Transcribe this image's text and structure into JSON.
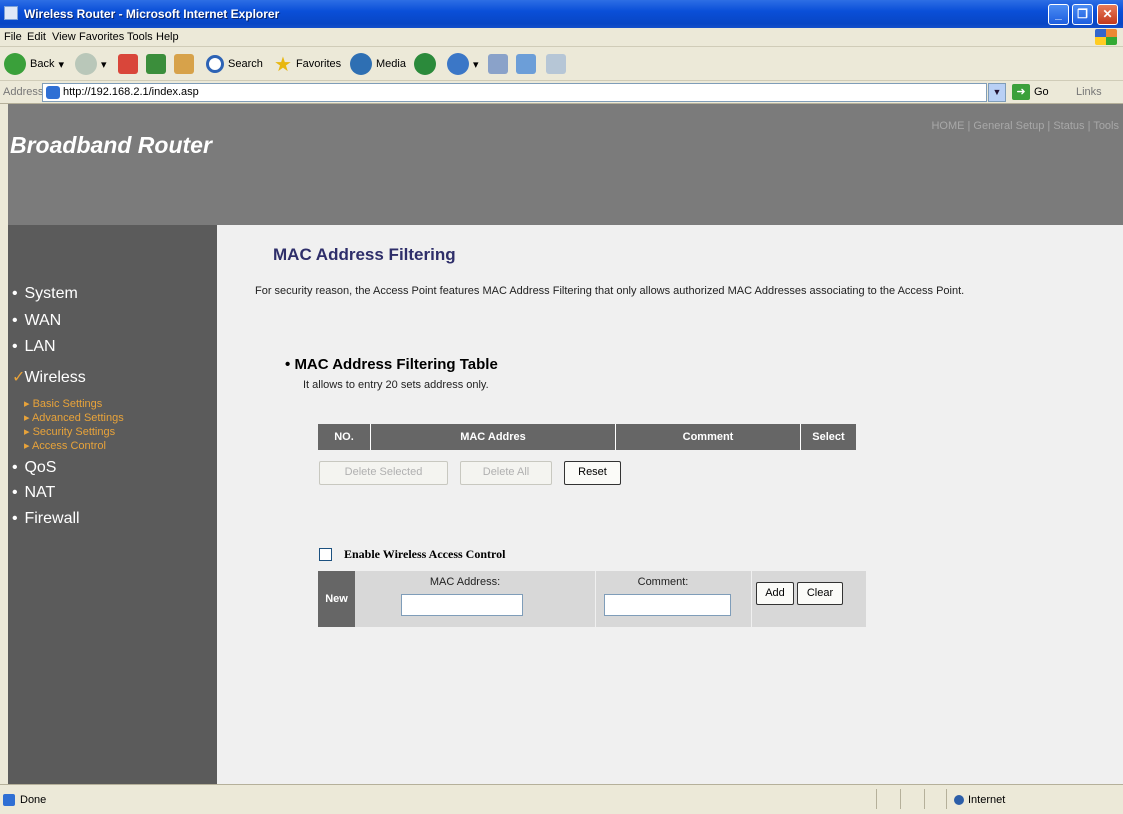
{
  "window": {
    "title": "Wireless Router - Microsoft Internet Explorer"
  },
  "menu": [
    "File",
    "Edit",
    "View",
    "Favorites",
    "Tools",
    "Help"
  ],
  "toolbar": {
    "back": "Back",
    "search": "Search",
    "favorites": "Favorites",
    "media": "Media"
  },
  "address": {
    "label": "Address",
    "url": "http://192.168.2.1/index.asp",
    "go": "Go",
    "links": "Links"
  },
  "header": {
    "brand": "Broadband Router",
    "nav": [
      "HOME",
      "General Setup",
      "Status",
      "Tools"
    ],
    "separator": "|"
  },
  "sidebar": {
    "items": [
      {
        "bullet": "•",
        "label": "System"
      },
      {
        "bullet": "•",
        "label": "WAN"
      },
      {
        "bullet": "•",
        "label": "LAN"
      },
      {
        "bullet": "✓",
        "label": "Wireless"
      },
      {
        "bullet": "•",
        "label": "QoS"
      },
      {
        "bullet": "•",
        "label": "NAT"
      },
      {
        "bullet": "•",
        "label": "Firewall"
      }
    ],
    "wireless_sub": [
      "▸ Basic Settings",
      "▸ Advanced Settings",
      "▸ Security Settings",
      "▸ Access Control"
    ]
  },
  "main": {
    "title": "MAC Address Filtering",
    "description": "For security reason, the Access Point features MAC Address Filtering that only allows authorized MAC Addresses associating to the Access Point.",
    "section_title": "MAC Address Filtering Table",
    "section_bullet": "•",
    "section_note": "It allows to entry 20 sets address only.",
    "table_headers": [
      "NO.",
      "MAC Addres",
      "Comment",
      "Select"
    ],
    "buttons": {
      "delete_selected": "Delete Selected",
      "delete_all": "Delete All",
      "reset": "Reset"
    },
    "enable_label": "Enable Wireless Access Control",
    "enable_checked": false,
    "form": {
      "row_label": "New",
      "mac_label": "MAC Address:",
      "mac_value": "",
      "comment_label": "Comment:",
      "comment_value": "",
      "add": "Add",
      "clear": "Clear"
    }
  },
  "status": {
    "text": "Done",
    "zone": "Internet"
  }
}
